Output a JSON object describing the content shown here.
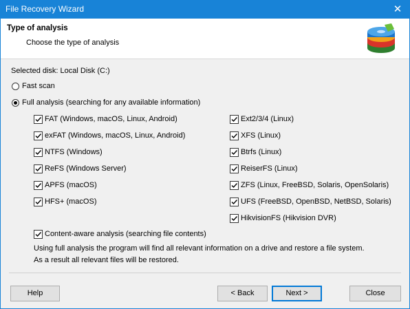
{
  "window": {
    "title": "File Recovery Wizard",
    "close_glyph": "✕"
  },
  "header": {
    "title": "Type of analysis",
    "subtitle": "Choose the type of analysis",
    "logo_icon": "disk-recovery-logo-icon"
  },
  "selected_disk": "Selected disk: Local Disk (C:)",
  "options": {
    "fast_scan": {
      "label": "Fast scan",
      "selected": false
    },
    "full_analysis": {
      "label": "Full analysis (searching for any available information)",
      "selected": true
    }
  },
  "filesystems_left": [
    {
      "label": "FAT (Windows, macOS, Linux, Android)",
      "checked": true
    },
    {
      "label": "exFAT (Windows, macOS, Linux, Android)",
      "checked": true
    },
    {
      "label": "NTFS (Windows)",
      "checked": true
    },
    {
      "label": "ReFS (Windows Server)",
      "checked": true
    },
    {
      "label": "APFS (macOS)",
      "checked": true
    },
    {
      "label": "HFS+ (macOS)",
      "checked": true
    }
  ],
  "filesystems_right": [
    {
      "label": "Ext2/3/4 (Linux)",
      "checked": true
    },
    {
      "label": "XFS (Linux)",
      "checked": true
    },
    {
      "label": "Btrfs (Linux)",
      "checked": true
    },
    {
      "label": "ReiserFS (Linux)",
      "checked": true
    },
    {
      "label": "ZFS (Linux, FreeBSD, Solaris, OpenSolaris)",
      "checked": true
    },
    {
      "label": "UFS (FreeBSD, OpenBSD, NetBSD, Solaris)",
      "checked": true
    },
    {
      "label": "HikvisionFS (Hikvision DVR)",
      "checked": true
    }
  ],
  "content_aware": {
    "label": "Content-aware analysis (searching file contents)",
    "checked": true
  },
  "info": {
    "line1": "Using full analysis the program will find all relevant information on a drive and restore a file system.",
    "line2": "As a result all relevant files will be restored."
  },
  "buttons": {
    "help": "Help",
    "back": "< Back",
    "next": "Next >",
    "close": "Close"
  },
  "colors": {
    "titlebar": "#1883d7",
    "default_button_border": "#0078d7"
  }
}
